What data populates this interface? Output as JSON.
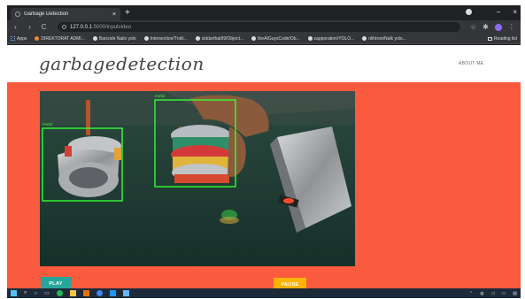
{
  "browser": {
    "tab_title": "Garbage Detection",
    "tab_close": "×",
    "new_tab": "+",
    "url_host": "127.0.0.1",
    "url_rest": ":5000/inputvideo",
    "back": "‹",
    "forward": "›",
    "reload": "C",
    "star": "☆",
    "minimize": "–",
    "close": "×",
    "bookmarks": [
      {
        "label": "Apps",
        "icon": "apps-icon"
      },
      {
        "label": "DIREKTORAT ADMI...",
        "icon": "site-icon"
      },
      {
        "label": "Barcode Nails yolo",
        "icon": "github-icon"
      },
      {
        "label": "Intersection/Trolli...",
        "icon": "github-icon"
      },
      {
        "label": "siddarthat99/Object...",
        "icon": "github-icon"
      },
      {
        "label": "theAIGuysCode/Ob...",
        "icon": "github-icon"
      },
      {
        "label": "zapporation/YOLO...",
        "icon": "github-icon"
      },
      {
        "label": "nlihtron/Nalk yolo...",
        "icon": "github-icon"
      }
    ],
    "reading_list": "Reading list"
  },
  "navbar": {
    "brand": "garbagedetection",
    "about": "ABOUT ME"
  },
  "video": {
    "detections": [
      {
        "label": "metal"
      },
      {
        "label": "metal"
      }
    ]
  },
  "controls": {
    "play": "PLAY",
    "pause": "PAUSE"
  },
  "colors": {
    "page_background": "#fa5a3d",
    "play_button": "#26a69a",
    "pause_button": "#ffb300",
    "detection_box": "#33ff33"
  }
}
